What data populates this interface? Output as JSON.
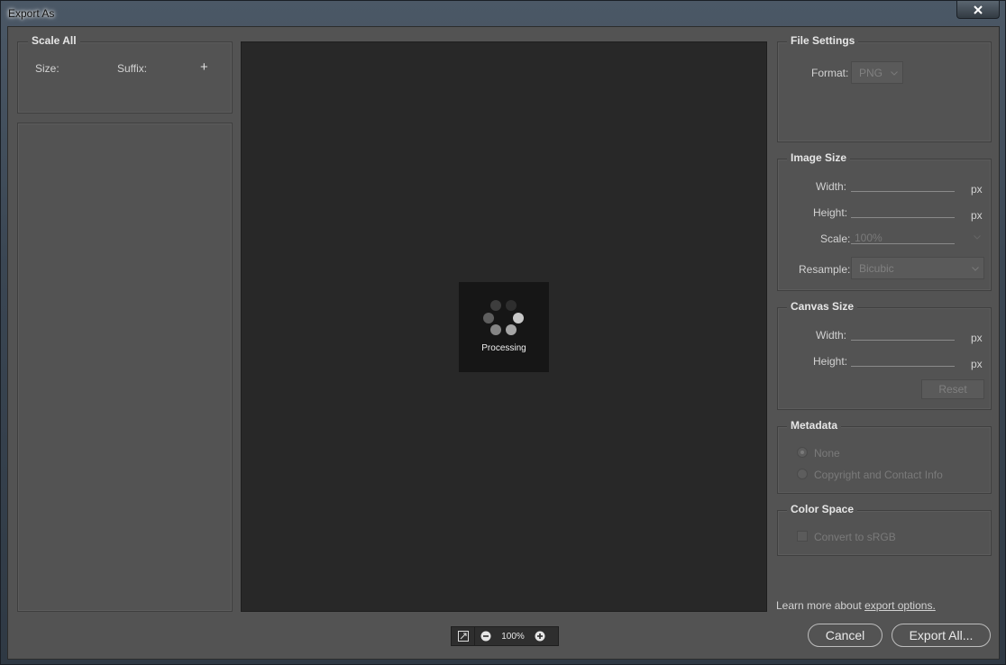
{
  "window": {
    "title": "Export As"
  },
  "scale_all": {
    "title": "Scale All",
    "size_label": "Size:",
    "suffix_label": "Suffix:",
    "add_symbol": "+"
  },
  "preview": {
    "processing_label": "Processing"
  },
  "zoom": {
    "level": "100%"
  },
  "file_settings": {
    "title": "File Settings",
    "format_label": "Format:",
    "format_value": "PNG"
  },
  "image_size": {
    "title": "Image Size",
    "width_label": "Width:",
    "height_label": "Height:",
    "scale_label": "Scale:",
    "scale_value": "100%",
    "resample_label": "Resample:",
    "resample_value": "Bicubic",
    "unit": "px"
  },
  "canvas_size": {
    "title": "Canvas Size",
    "width_label": "Width:",
    "height_label": "Height:",
    "unit": "px",
    "reset_label": "Reset"
  },
  "metadata": {
    "title": "Metadata",
    "option_none": "None",
    "option_copyright": "Copyright and Contact Info"
  },
  "color_space": {
    "title": "Color Space",
    "convert_label": "Convert to sRGB"
  },
  "footer": {
    "learn_more_prefix": "Learn more about ",
    "learn_more_link": "export options.",
    "cancel_label": "Cancel",
    "export_label": "Export All..."
  },
  "colors": {
    "panel_bg": "#535353",
    "preview_bg": "#282828",
    "processing_bg": "#161616"
  }
}
